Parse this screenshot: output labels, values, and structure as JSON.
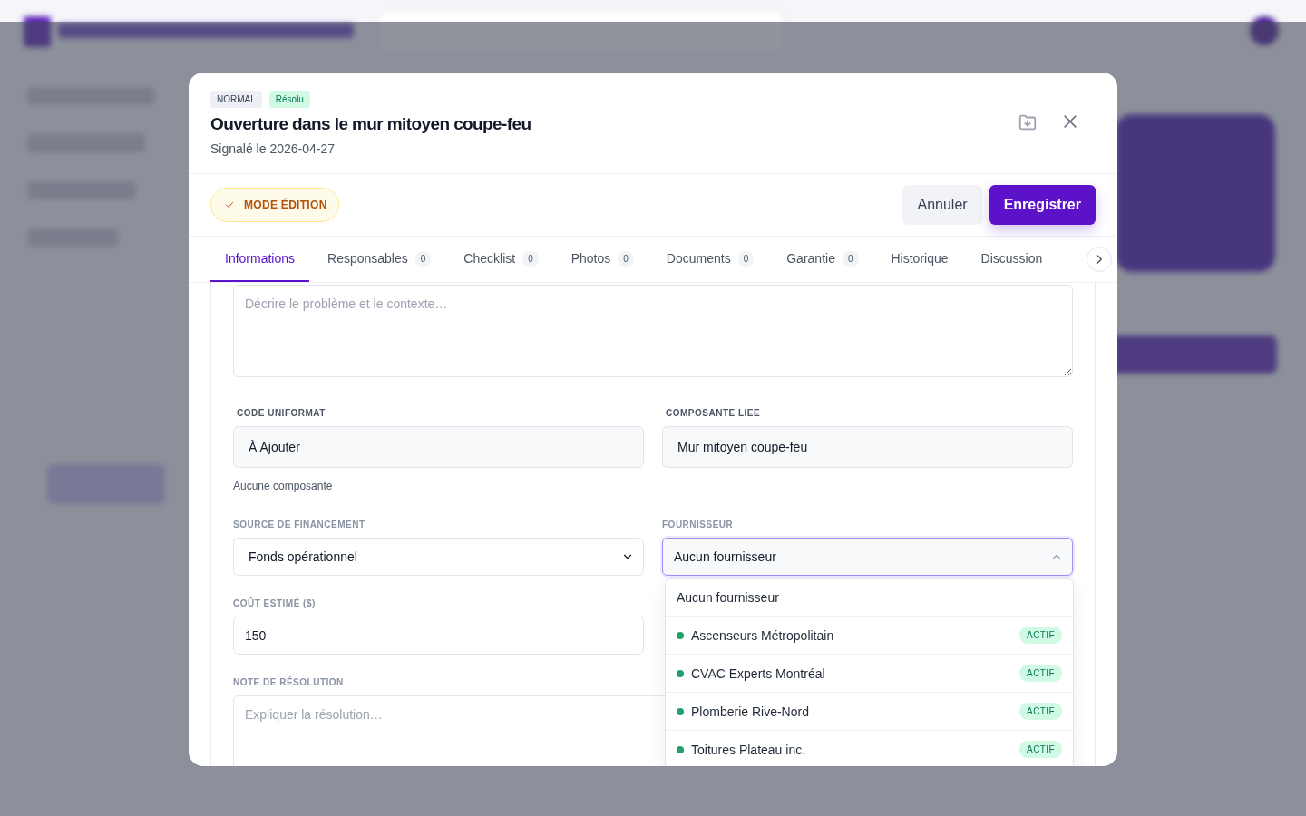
{
  "badges": [
    {
      "label": "NORMAL",
      "kind": "priority"
    },
    {
      "label": "Résolu",
      "kind": "status"
    }
  ],
  "title": "Ouverture dans le mur mitoyen coupe-feu",
  "subtitle": "Signalé le 2026-04-27",
  "edit_mode": {
    "label": "MODE ÉDITION",
    "on": true
  },
  "buttons": [
    {
      "label": "Annuler",
      "kind": "secondary"
    },
    {
      "label": "Enregistrer",
      "kind": "primary"
    }
  ],
  "tabs": [
    {
      "label": "Informations",
      "selected": true
    },
    {
      "label": "Responsables",
      "count": "0",
      "selected": false
    },
    {
      "label": "Checklist",
      "count": "0",
      "selected": false
    },
    {
      "label": "Photos",
      "count": "0",
      "selected": false
    },
    {
      "label": "Documents",
      "count": "0",
      "selected": false
    },
    {
      "label": "Garantie",
      "count": "0",
      "selected": false
    },
    {
      "label": "Historique",
      "selected": false
    },
    {
      "label": "Discussion",
      "selected": false
    }
  ],
  "description": {
    "placeholder": "Décrire le problème et le contexte…"
  },
  "code_uniformat": {
    "label": "CODE UNIFORMAT",
    "value": "À Ajouter",
    "help": "Aucune composante"
  },
  "composante_liee": {
    "label": "COMPOSANTE LIEE",
    "value": "Mur mitoyen coupe-feu"
  },
  "source_financement": {
    "label": "SOURCE DE FINANCEMENT",
    "value": "Fonds opérationnel"
  },
  "fournisseur": {
    "label": "FOURNISSEUR",
    "value": "Aucun fournisseur",
    "expanded": true,
    "options": [
      {
        "label": "Aucun fournisseur",
        "kind": "none"
      },
      {
        "label": "Ascenseurs Métropolitain",
        "kind": "supplier",
        "status": "ACTIF",
        "color": "#22a06b"
      },
      {
        "label": "CVAC Experts Montréal",
        "kind": "supplier",
        "status": "ACTIF",
        "color": "#22a06b"
      },
      {
        "label": "Plomberie Rive-Nord",
        "kind": "supplier",
        "status": "ACTIF",
        "color": "#22a06b"
      },
      {
        "label": "Toitures Plateau inc.",
        "kind": "supplier",
        "status": "ACTIF",
        "color": "#22a06b"
      }
    ]
  },
  "cout_estime": {
    "label": "COÛT ESTIMÉ ($)",
    "value": "150"
  },
  "note_resolution": {
    "label": "NOTE DE RÉSOLUTION",
    "placeholder": "Expliquer la résolution…"
  }
}
